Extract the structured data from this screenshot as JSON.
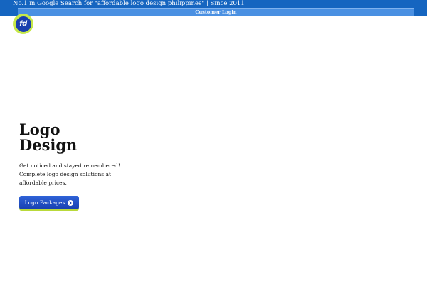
{
  "header": {
    "tagline": "No.1 in Google Search for \"affordable logo design philippines\" | Since 2011",
    "login_label": "Customer Login"
  },
  "brand": {
    "logo_text": "fd",
    "colors": {
      "ring": "#c6e84a",
      "core": "#1a3fae"
    }
  },
  "hero": {
    "title_line1": "Logo",
    "title_line2": "Design",
    "description": "Get noticed and stayed remembered! Complete logo design solutions at affordable prices.",
    "cta_label": "Logo Packages",
    "cta_icon": "arrow-right-circle-icon"
  },
  "colors": {
    "topbar": "#1565c0",
    "login_button": "#4a90e2",
    "cta": "#2f63d8",
    "cta_underline": "#b9d93a"
  }
}
